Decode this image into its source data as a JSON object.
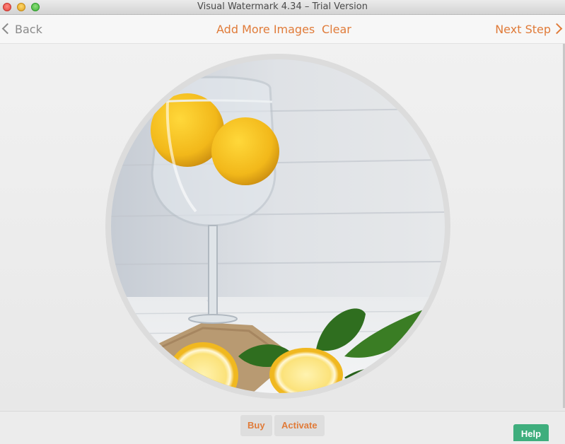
{
  "window": {
    "title": "Visual Watermark 4.34 – Trial Version"
  },
  "toolbar": {
    "back_label": "Back",
    "add_more_label": "Add More Images",
    "clear_label": "Clear",
    "next_label": "Next Step"
  },
  "footer": {
    "buy_label": "Buy",
    "activate_label": "Activate",
    "help_label": "Help"
  },
  "colors": {
    "accent": "#e07b39",
    "help": "#3fae7d"
  },
  "icons": [
    "close-icon",
    "minimize-icon",
    "maximize-icon",
    "chevron-left-icon",
    "chevron-right-icon"
  ]
}
